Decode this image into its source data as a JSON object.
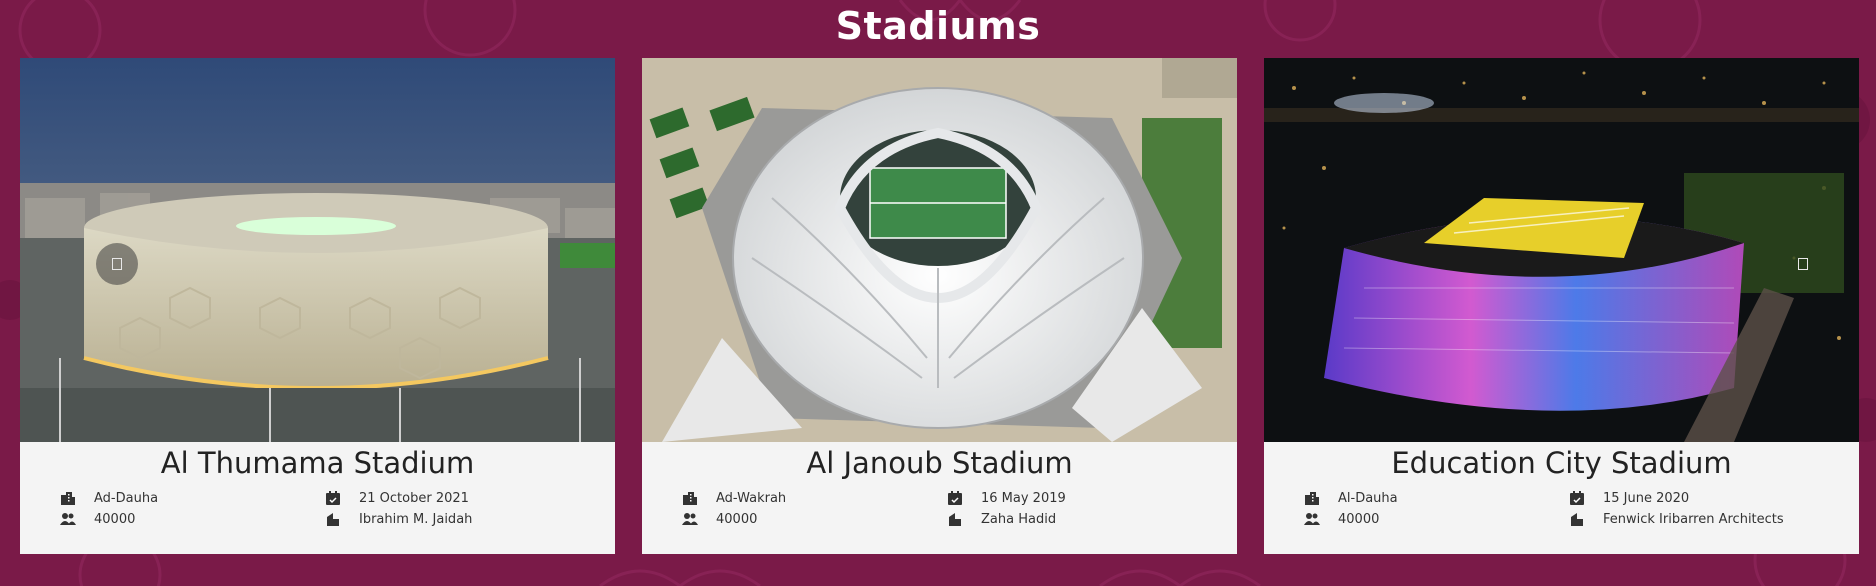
{
  "page": {
    "title": "Stadiums"
  },
  "carousel": {
    "prev_icon": "arrow-left-icon",
    "next_icon": "arrow-right-icon"
  },
  "colors": {
    "background": "#7a1a48",
    "card": "#f4f4f4",
    "title_text": "#ffffff"
  },
  "stadiums": [
    {
      "name": "Al Thumama Stadium",
      "city": "Ad-Dauha",
      "capacity": "40000",
      "opened": "21 October 2021",
      "architect": "Ibrahim M. Jaidah"
    },
    {
      "name": "Al Janoub Stadium",
      "city": "Ad-Wakrah",
      "capacity": "40000",
      "opened": "16 May 2019",
      "architect": "Zaha Hadid"
    },
    {
      "name": "Education City Stadium",
      "city": "Al-Dauha",
      "capacity": "40000",
      "opened": "15 June 2020",
      "architect": "Fenwick Iribarren Architects"
    }
  ]
}
